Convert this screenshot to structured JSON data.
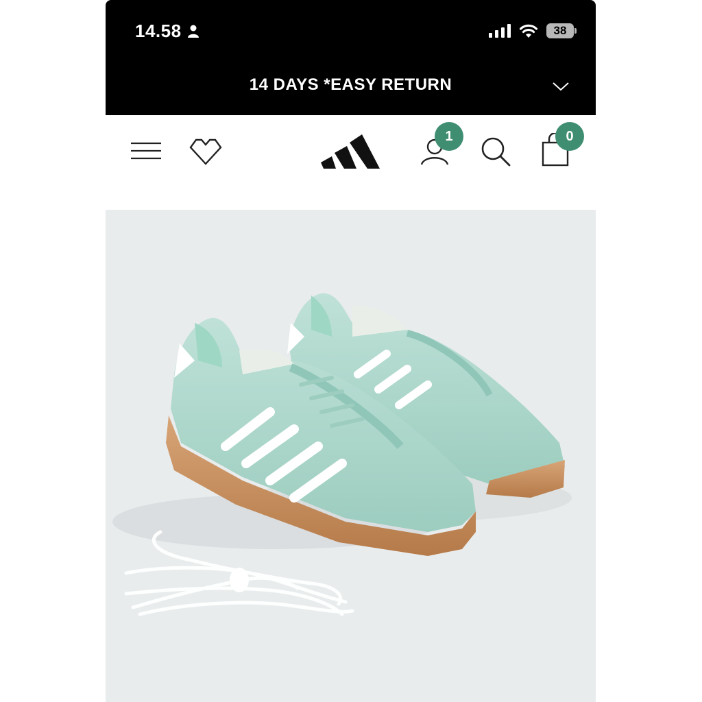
{
  "status_bar": {
    "time": "14.58",
    "battery": "38"
  },
  "promo_bar": {
    "text": "14 DAYS *EASY RETURN"
  },
  "nav": {
    "account_badge": "1",
    "cart_badge": "0"
  },
  "colors": {
    "accent": "#3f8e72",
    "header_bg": "#000000",
    "image_bg": "#e9eced"
  },
  "icons": [
    "person-icon",
    "signal-icon",
    "wifi-icon",
    "battery-icon",
    "chevron-down-icon",
    "menu-icon",
    "heart-icon",
    "adidas-logo",
    "account-icon",
    "search-icon",
    "cart-icon"
  ],
  "product": {
    "image": "mint green suede sneakers with white stripes and gum sole, with spare white laces"
  }
}
